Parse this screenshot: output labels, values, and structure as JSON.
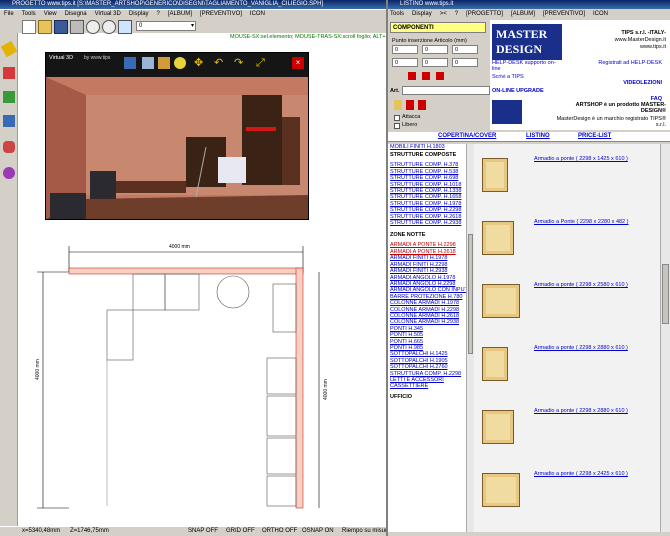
{
  "left_window": {
    "title": "PROGETTO     www.tips.it   [S:\\MASTER_ARTSHOP\\GENERICO\\DISEGNI\\TAGLIAMENTO_VANIGLIA_CILIEGIO.SPH]",
    "menu": [
      "File",
      "Tools",
      "View",
      "Disegna",
      "Virtual 3D",
      "Display",
      "?",
      "[ALBUM]",
      "[PREVENTIVO]",
      "ICON"
    ],
    "layer_select": "0",
    "hint_text": "MOUSE-SX:sel.elemento; MOUSE-TRAS-SX:scroll foglio; ALT+MOUSE",
    "viewer_title": "Virtual 3D",
    "viewer_subtitle": "by www.tips",
    "dim_top": "4000 mm",
    "dim_left": "4000 mm",
    "dim_right": "4000 mm",
    "status": {
      "coords_x": "x=5340,48mm",
      "coords_z": "Z=1746,75mm",
      "snap": "SNAP OFF",
      "grid": "GRID OFF",
      "ortho": "ORTHO OFF",
      "osnap": "OSNAP ON",
      "fill": "Riempo su misura"
    }
  },
  "right_window": {
    "title": "LISTINO     www.tips.it",
    "menu": [
      "Tools",
      "Display",
      "><",
      "?",
      "[PROGETTO]",
      "[ALBUM]",
      "[PREVENTIVO]",
      "ICON"
    ],
    "componenti_label": "COMPONENTI",
    "punto_label": "Punto inserzione Articolo (mm)",
    "coord_x": "0",
    "coord_y": "0",
    "coord_z": "0",
    "coord_a": "0",
    "coord_b": "0",
    "coord_c": "0",
    "art_label": "Art.",
    "attacca_label": "Attacca",
    "libero_label": "Libero",
    "brand_line1": "MASTER",
    "brand_line2": "DESIGN",
    "company": "TIPS s.r.l. -ITALY-",
    "company_url": "www.MasterDesign.it",
    "company_url2": "www.tips.it",
    "help_desk": "HELP-DESK supporto on-line",
    "registrati": "Registrati ad HELP-DESK",
    "scrivi": "Scrivi a TIPS",
    "videolezioni": "VIDEOLEZIONI",
    "online_upgrade": "ON-LINE UPGRADE",
    "faq": "FAQ",
    "artshop_text": "ARTSHOP è un prodotto MASTER-DESIGN®",
    "marchio_text": "MasterDesign è un marchio registrato TIPS® s.r.l.",
    "tabs": [
      "COPERTINA/COVER",
      "LISTINO",
      "PRICE-LIST"
    ],
    "list_top": "MOBILI FINITI H.1803",
    "section1": "STRUTTURE COMPOSTE",
    "list1": [
      "STRUTTURE COMP. H.378",
      "STRUTTURE COMP. H.538",
      "STRUTTURE COMP. H.698",
      "STRUTTURE COMP. H.1018",
      "STRUTTURE COMP. H.1338",
      "STRUTTURE COMP. H.1658",
      "STRUTTURE COMP. H.1978",
      "STRUTTURE COMP. H.2298",
      "STRUTTURE COMP. H.2618",
      "STRUTTURE COMP. H.2938"
    ],
    "section2": "ZONE NOTTE",
    "list2_hot": [
      "ARMADI A PONTE H.2298",
      "ARMADI A PONTE H.2618"
    ],
    "list2": [
      "ARMADI FINITI H.1978",
      "ARMADI FINITI H.2298",
      "ARMADI FINITI H.2938",
      "ARMADI ANGOLO H.1978",
      "ARMADI ANGOLO H.2298",
      "ARMADI ANGOLO CON INPUT",
      "BARRE PROTEZIONE H.780",
      "COLONNE ARMADI H.1978",
      "COLONNE ARMADI H.2298",
      "COLONNE ARMADI H.2618",
      "COLONNE ARMADI H.2938",
      "PONTI H.345",
      "PONTI H.505",
      "PONTI H.665",
      "PONTI H.985",
      "SOTTOPALCHI H.1425",
      "SOTTOPALCHI H.1905",
      "SOTTOPALCHI H.2760",
      "STRUTTURA COMP. H.2298",
      "LETTI E ACCESSORI",
      "CASSETTIERE"
    ],
    "section3": "UFFICIO",
    "products": [
      "Armadio a ponte ( 2298 x 1425 x 610 )",
      "Armadio a Ponte ( 2298 x 2280 x 482 )",
      "Armadio a ponte ( 2298 x 2580 x 610 )",
      "Armadio a ponte ( 2298 x 2880 x 610 )",
      "Armadio a ponte ( 2298 x 2880 x 610 )",
      "Armadio a ponte ( 2298 x 2425 x 610 )"
    ]
  },
  "colors": {
    "titlebar": "#0a246a",
    "brand_blue": "#1a2f8a",
    "link_blue": "#0000cc",
    "link_red": "#c00000",
    "yellow_field": "#ffff80"
  }
}
